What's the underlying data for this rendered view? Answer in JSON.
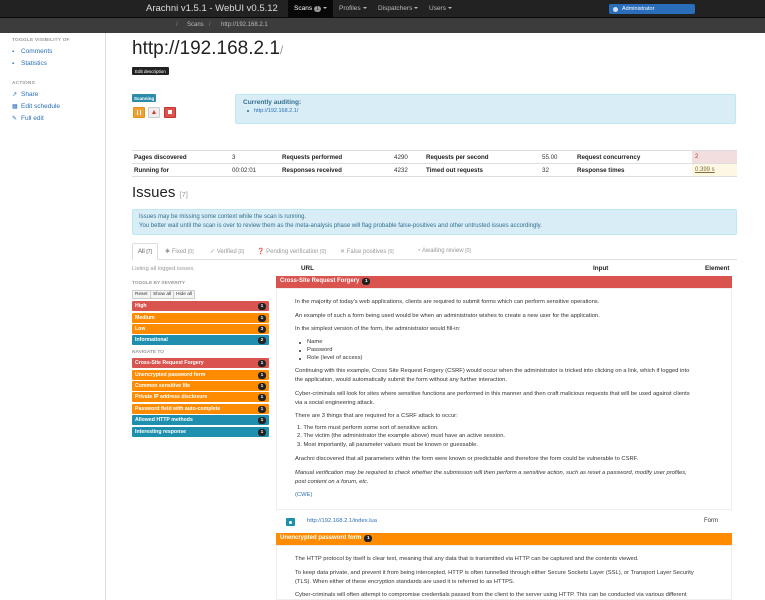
{
  "navbar": {
    "brand": "Arachni v1.5.1 - WebUI v0.5.12",
    "scans_label": "Scans",
    "scans_count": "1",
    "profiles_label": "Profiles",
    "dispatchers_label": "Dispatchers",
    "users_label": "Users",
    "admin_label": "Administrator"
  },
  "breadcrumb": {
    "sep": "/",
    "scans": "Scans",
    "current": "http://192.168.2.1"
  },
  "sidebar": {
    "toggle_heading": "TOGGLE VISIBILITY OF",
    "comments": "Comments",
    "statistics": "Statistics",
    "actions_heading": "ACTIONS",
    "share": "Share",
    "edit_schedule": "Edit schedule",
    "full_edit": "Full edit"
  },
  "page": {
    "title": "http://192.168.2.1",
    "title_slash": "/",
    "edit_description": "Edit description",
    "status_label": "Scanning",
    "auditing_heading": "Currently auditing:",
    "auditing_url": "http://192.168.2.1/"
  },
  "stats": {
    "pages_discovered_label": "Pages discovered",
    "pages_discovered": "3",
    "requests_performed_label": "Requests performed",
    "requests_performed": "4290",
    "requests_per_second_label": "Requests per second",
    "requests_per_second": "55.00",
    "request_concurrency_label": "Request concurrency",
    "request_concurrency": "2",
    "running_for_label": "Running for",
    "running_for": "00:02:01",
    "responses_received_label": "Responses received",
    "responses_received": "4232",
    "timed_out_label": "Timed out requests",
    "timed_out": "32",
    "response_times_label": "Response times",
    "response_times": "0.399 s"
  },
  "issues": {
    "heading": "Issues",
    "count": "[7]",
    "notice_line1": "Issues may be missing some context while the scan is running.",
    "notice_line2": "You better wait until the scan is over to review them as the meta-analysis phase will flag probable false-positives and other untrusted issues accordingly.",
    "tabs": [
      {
        "label": "All",
        "count": "[7]"
      },
      {
        "label": "Fixed",
        "count": "[0]"
      },
      {
        "label": "Verified",
        "count": "[0]"
      },
      {
        "label": "Pending verification",
        "count": "[0]"
      },
      {
        "label": "False positives",
        "count": "[0]"
      },
      {
        "label": "Awaiting review",
        "count": "[0]"
      }
    ],
    "listing": "Listing all logged issues.",
    "toggle_by_severity": "TOGGLE BY SEVERITY",
    "reset": "Reset",
    "show_all": "Show all",
    "hide_all": "Hide all",
    "severities": [
      {
        "label": "High",
        "count": "1"
      },
      {
        "label": "Medium",
        "count": "1"
      },
      {
        "label": "Low",
        "count": "3"
      },
      {
        "label": "Informational",
        "count": "2"
      }
    ],
    "navigate_to": "NAVIGATE TO",
    "nav_items": [
      {
        "label": "Cross-Site Request Forgery",
        "count": "1"
      },
      {
        "label": "Unencrypted password form",
        "count": "1"
      },
      {
        "label": "Common sensitive file",
        "count": "1"
      },
      {
        "label": "Private IP address disclosure",
        "count": "1"
      },
      {
        "label": "Password field with auto-complete",
        "count": "1"
      },
      {
        "label": "Allowed HTTP methods",
        "count": "1"
      },
      {
        "label": "Interesting response",
        "count": "1"
      }
    ],
    "columns": {
      "url": "URL",
      "input": "Input",
      "element": "Element"
    },
    "csrf": {
      "title": "Cross-Site Request Forgery",
      "count": "1",
      "p1": "In the majority of today's web applications, clients are required to submit forms which can perform sensitive operations.",
      "p2": "An example of such a form being used would be when an administrator wishes to create a new user for the application.",
      "p3": "In the simplest version of the form, the administrator would fill-in:",
      "li1": "Name",
      "li2": "Password",
      "li3": "Role (level of access)",
      "p4a": "Continuing with this example, Cross Site Request Forgery (CSRF) would occur when the administrator is tricked into clicking on a link, which if logged into",
      "p4b": "the application, would automatically submit the form without any further interaction.",
      "p5a": "Cyber-criminals will look for sites where sensitive functions are performed in this manner and then craft malicious requests that will be used against clients",
      "p5b": "via a social engineering attack.",
      "p6": "There are 3 things that are required for a CSRF attack to occur:",
      "o1": "1. The form must perform some sort of sensitive action.",
      "o2": "2. The victim (the administrator the example above) must have an active session.",
      "o3": "3. Most importantly, all parameter values must be known or guessable.",
      "p7": "Arachni discovered that all parameters within the form were known or predictable and therefore the form could be vulnerable to CSRF.",
      "p8a": "Manual verification may be required to check whether the submission will then perform a sensitive action, such as reset a password, modify user profiles,",
      "p8b": "post content on a forum, etc.",
      "cwe": "(CWE)",
      "url": "http://192.168.2.1/index.lua",
      "element": "Form"
    },
    "unenc": {
      "title": "Unencrypted password form",
      "count": "1",
      "p1": "The HTTP protocol by itself is clear text, meaning that any data that is transmitted via HTTP can be captured and the contents viewed.",
      "p2a": "To keep data private, and prevent it from being intercepted, HTTP is often tunnelled through either Secure Sockets Layer (SSL), or Transport Layer Security",
      "p2b": "(TLS). When either of these encryption standards are used it is referred to as HTTPS.",
      "p3": "Cyber-criminals will often attempt to compromise credentials passed from the client to the server using HTTP. This can be conducted via various different"
    }
  },
  "colors": {
    "high": "#d9534f",
    "medium": "#ff8c00",
    "informational": "#1f8fb0"
  }
}
